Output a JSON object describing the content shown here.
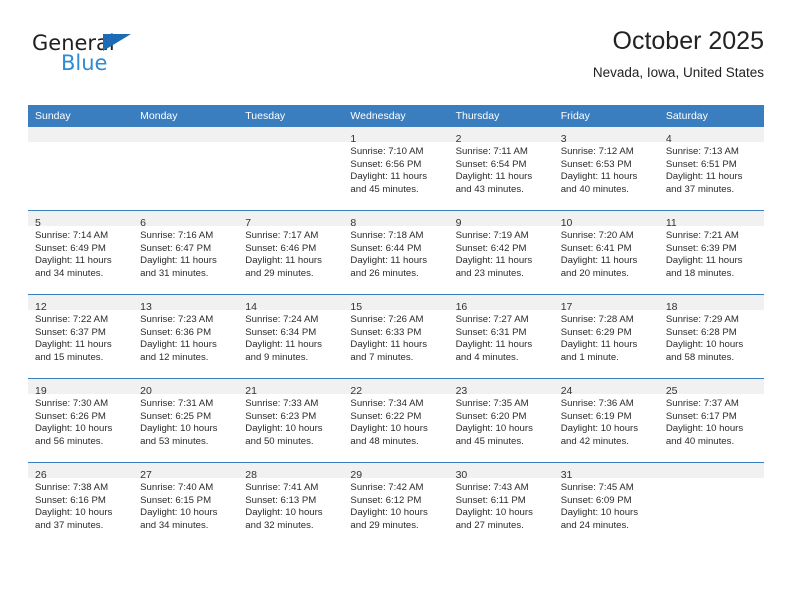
{
  "brand": {
    "name_part1": "General",
    "name_part2": "Blue",
    "triangle_color": "#1b6cb5",
    "blue_color": "#2e8bd4"
  },
  "header": {
    "title": "October 2025",
    "subtitle": "Nevada, Iowa, United States"
  },
  "theme": {
    "header_row_bg": "#3b7ebf",
    "daynum_band_bg": "#f1f1f1",
    "grid_line": "#3b7ebf"
  },
  "weekday_headers": [
    "Sunday",
    "Monday",
    "Tuesday",
    "Wednesday",
    "Thursday",
    "Friday",
    "Saturday"
  ],
  "weeks": [
    [
      {
        "day": "",
        "sunrise": "",
        "sunset": "",
        "daylight1": "",
        "daylight2": ""
      },
      {
        "day": "",
        "sunrise": "",
        "sunset": "",
        "daylight1": "",
        "daylight2": ""
      },
      {
        "day": "",
        "sunrise": "",
        "sunset": "",
        "daylight1": "",
        "daylight2": ""
      },
      {
        "day": "1",
        "sunrise": "Sunrise: 7:10 AM",
        "sunset": "Sunset: 6:56 PM",
        "daylight1": "Daylight: 11 hours",
        "daylight2": "and 45 minutes."
      },
      {
        "day": "2",
        "sunrise": "Sunrise: 7:11 AM",
        "sunset": "Sunset: 6:54 PM",
        "daylight1": "Daylight: 11 hours",
        "daylight2": "and 43 minutes."
      },
      {
        "day": "3",
        "sunrise": "Sunrise: 7:12 AM",
        "sunset": "Sunset: 6:53 PM",
        "daylight1": "Daylight: 11 hours",
        "daylight2": "and 40 minutes."
      },
      {
        "day": "4",
        "sunrise": "Sunrise: 7:13 AM",
        "sunset": "Sunset: 6:51 PM",
        "daylight1": "Daylight: 11 hours",
        "daylight2": "and 37 minutes."
      }
    ],
    [
      {
        "day": "5",
        "sunrise": "Sunrise: 7:14 AM",
        "sunset": "Sunset: 6:49 PM",
        "daylight1": "Daylight: 11 hours",
        "daylight2": "and 34 minutes."
      },
      {
        "day": "6",
        "sunrise": "Sunrise: 7:16 AM",
        "sunset": "Sunset: 6:47 PM",
        "daylight1": "Daylight: 11 hours",
        "daylight2": "and 31 minutes."
      },
      {
        "day": "7",
        "sunrise": "Sunrise: 7:17 AM",
        "sunset": "Sunset: 6:46 PM",
        "daylight1": "Daylight: 11 hours",
        "daylight2": "and 29 minutes."
      },
      {
        "day": "8",
        "sunrise": "Sunrise: 7:18 AM",
        "sunset": "Sunset: 6:44 PM",
        "daylight1": "Daylight: 11 hours",
        "daylight2": "and 26 minutes."
      },
      {
        "day": "9",
        "sunrise": "Sunrise: 7:19 AM",
        "sunset": "Sunset: 6:42 PM",
        "daylight1": "Daylight: 11 hours",
        "daylight2": "and 23 minutes."
      },
      {
        "day": "10",
        "sunrise": "Sunrise: 7:20 AM",
        "sunset": "Sunset: 6:41 PM",
        "daylight1": "Daylight: 11 hours",
        "daylight2": "and 20 minutes."
      },
      {
        "day": "11",
        "sunrise": "Sunrise: 7:21 AM",
        "sunset": "Sunset: 6:39 PM",
        "daylight1": "Daylight: 11 hours",
        "daylight2": "and 18 minutes."
      }
    ],
    [
      {
        "day": "12",
        "sunrise": "Sunrise: 7:22 AM",
        "sunset": "Sunset: 6:37 PM",
        "daylight1": "Daylight: 11 hours",
        "daylight2": "and 15 minutes."
      },
      {
        "day": "13",
        "sunrise": "Sunrise: 7:23 AM",
        "sunset": "Sunset: 6:36 PM",
        "daylight1": "Daylight: 11 hours",
        "daylight2": "and 12 minutes."
      },
      {
        "day": "14",
        "sunrise": "Sunrise: 7:24 AM",
        "sunset": "Sunset: 6:34 PM",
        "daylight1": "Daylight: 11 hours",
        "daylight2": "and 9 minutes."
      },
      {
        "day": "15",
        "sunrise": "Sunrise: 7:26 AM",
        "sunset": "Sunset: 6:33 PM",
        "daylight1": "Daylight: 11 hours",
        "daylight2": "and 7 minutes."
      },
      {
        "day": "16",
        "sunrise": "Sunrise: 7:27 AM",
        "sunset": "Sunset: 6:31 PM",
        "daylight1": "Daylight: 11 hours",
        "daylight2": "and 4 minutes."
      },
      {
        "day": "17",
        "sunrise": "Sunrise: 7:28 AM",
        "sunset": "Sunset: 6:29 PM",
        "daylight1": "Daylight: 11 hours",
        "daylight2": "and 1 minute."
      },
      {
        "day": "18",
        "sunrise": "Sunrise: 7:29 AM",
        "sunset": "Sunset: 6:28 PM",
        "daylight1": "Daylight: 10 hours",
        "daylight2": "and 58 minutes."
      }
    ],
    [
      {
        "day": "19",
        "sunrise": "Sunrise: 7:30 AM",
        "sunset": "Sunset: 6:26 PM",
        "daylight1": "Daylight: 10 hours",
        "daylight2": "and 56 minutes."
      },
      {
        "day": "20",
        "sunrise": "Sunrise: 7:31 AM",
        "sunset": "Sunset: 6:25 PM",
        "daylight1": "Daylight: 10 hours",
        "daylight2": "and 53 minutes."
      },
      {
        "day": "21",
        "sunrise": "Sunrise: 7:33 AM",
        "sunset": "Sunset: 6:23 PM",
        "daylight1": "Daylight: 10 hours",
        "daylight2": "and 50 minutes."
      },
      {
        "day": "22",
        "sunrise": "Sunrise: 7:34 AM",
        "sunset": "Sunset: 6:22 PM",
        "daylight1": "Daylight: 10 hours",
        "daylight2": "and 48 minutes."
      },
      {
        "day": "23",
        "sunrise": "Sunrise: 7:35 AM",
        "sunset": "Sunset: 6:20 PM",
        "daylight1": "Daylight: 10 hours",
        "daylight2": "and 45 minutes."
      },
      {
        "day": "24",
        "sunrise": "Sunrise: 7:36 AM",
        "sunset": "Sunset: 6:19 PM",
        "daylight1": "Daylight: 10 hours",
        "daylight2": "and 42 minutes."
      },
      {
        "day": "25",
        "sunrise": "Sunrise: 7:37 AM",
        "sunset": "Sunset: 6:17 PM",
        "daylight1": "Daylight: 10 hours",
        "daylight2": "and 40 minutes."
      }
    ],
    [
      {
        "day": "26",
        "sunrise": "Sunrise: 7:38 AM",
        "sunset": "Sunset: 6:16 PM",
        "daylight1": "Daylight: 10 hours",
        "daylight2": "and 37 minutes."
      },
      {
        "day": "27",
        "sunrise": "Sunrise: 7:40 AM",
        "sunset": "Sunset: 6:15 PM",
        "daylight1": "Daylight: 10 hours",
        "daylight2": "and 34 minutes."
      },
      {
        "day": "28",
        "sunrise": "Sunrise: 7:41 AM",
        "sunset": "Sunset: 6:13 PM",
        "daylight1": "Daylight: 10 hours",
        "daylight2": "and 32 minutes."
      },
      {
        "day": "29",
        "sunrise": "Sunrise: 7:42 AM",
        "sunset": "Sunset: 6:12 PM",
        "daylight1": "Daylight: 10 hours",
        "daylight2": "and 29 minutes."
      },
      {
        "day": "30",
        "sunrise": "Sunrise: 7:43 AM",
        "sunset": "Sunset: 6:11 PM",
        "daylight1": "Daylight: 10 hours",
        "daylight2": "and 27 minutes."
      },
      {
        "day": "31",
        "sunrise": "Sunrise: 7:45 AM",
        "sunset": "Sunset: 6:09 PM",
        "daylight1": "Daylight: 10 hours",
        "daylight2": "and 24 minutes."
      },
      {
        "day": "",
        "sunrise": "",
        "sunset": "",
        "daylight1": "",
        "daylight2": ""
      }
    ]
  ]
}
